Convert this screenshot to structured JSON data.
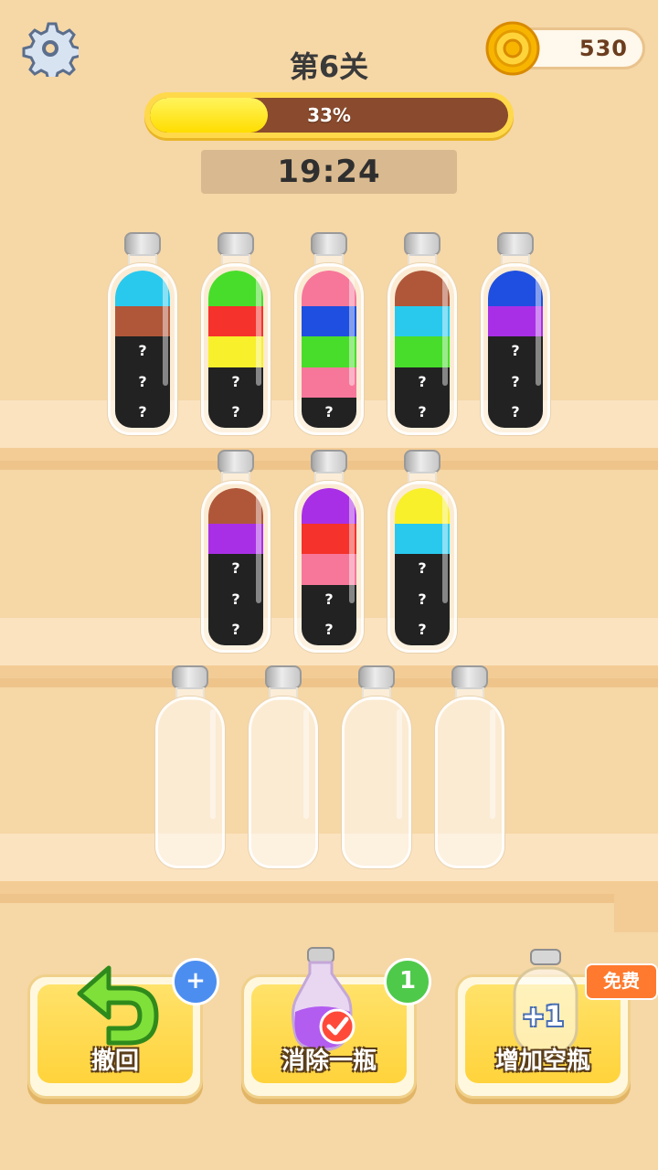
{
  "header": {
    "level_title": "第6关",
    "coins": "530",
    "progress_label": "33%",
    "progress_fraction": 0.33,
    "timer": "19:24"
  },
  "colors": {
    "cyan": "#29c9ee",
    "brown": "#b0573a",
    "green": "#48dd2a",
    "red": "#f5322b",
    "yellow": "#f8f02a",
    "pink": "#f7779a",
    "blue": "#1f4fe0",
    "purple": "#a92fe6",
    "hidden": "#222222"
  },
  "bottles": [
    {
      "id": "b1",
      "layers": [
        "cyan",
        "brown",
        "hidden",
        "hidden",
        "hidden"
      ]
    },
    {
      "id": "b2",
      "layers": [
        "green",
        "red",
        "yellow",
        "hidden",
        "hidden"
      ]
    },
    {
      "id": "b3",
      "layers": [
        "pink",
        "blue",
        "green",
        "pink",
        "hidden"
      ]
    },
    {
      "id": "b4",
      "layers": [
        "brown",
        "cyan",
        "green",
        "hidden",
        "hidden"
      ]
    },
    {
      "id": "b5",
      "layers": [
        "blue",
        "purple",
        "hidden",
        "hidden",
        "hidden"
      ]
    },
    {
      "id": "b6",
      "layers": [
        "brown",
        "purple",
        "hidden",
        "hidden",
        "hidden"
      ]
    },
    {
      "id": "b7",
      "layers": [
        "purple",
        "red",
        "pink",
        "hidden",
        "hidden"
      ]
    },
    {
      "id": "b8",
      "layers": [
        "yellow",
        "cyan",
        "hidden",
        "hidden",
        "hidden"
      ]
    },
    {
      "id": "b9",
      "layers": []
    },
    {
      "id": "b10",
      "layers": []
    },
    {
      "id": "b11",
      "layers": []
    },
    {
      "id": "b12",
      "layers": []
    }
  ],
  "hidden_mark": "?",
  "actions": {
    "undo_label": "撤回",
    "undo_badge": "+",
    "remove_label": "消除一瓶",
    "remove_badge": "1",
    "add_label": "增加空瓶",
    "add_icon_text": "+1",
    "add_badge": "免费"
  }
}
